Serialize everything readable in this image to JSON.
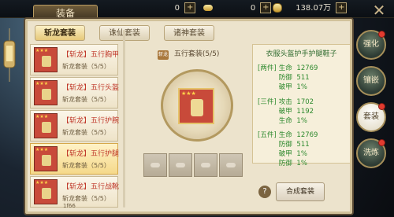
{
  "header": {
    "title": "装备",
    "currency_1": "0",
    "currency_2": "0",
    "currency_3": "138.07万"
  },
  "tabs": [
    "斩龙套装",
    "诛仙套装",
    "诸神套装"
  ],
  "list_items": [
    {
      "name": "【斩龙】五行胸甲",
      "set": "斩龙套装（5/5）",
      "selected": false
    },
    {
      "name": "【斩龙】五行头盔",
      "set": "斩龙套装（5/5）",
      "selected": false
    },
    {
      "name": "【斩龙】五行护腕",
      "set": "斩龙套装（5/5）",
      "selected": false
    },
    {
      "name": "【斩龙】五行护腿",
      "set": "斩龙套装（5/5）",
      "selected": true
    },
    {
      "name": "【斩龙】五行战靴",
      "set": "斩龙套装（5/5）",
      "selected": false
    }
  ],
  "center": {
    "badge": "斩龙",
    "set_label": "五行套装(5/5)"
  },
  "info": {
    "title": "衣服头盔护手护腿鞋子",
    "rows": [
      {
        "tier": "[两件]",
        "k": "生命",
        "v": "12769"
      },
      {
        "tier": "",
        "k": "防御",
        "v": "511"
      },
      {
        "tier": "",
        "k": "破甲",
        "v": "1%"
      },
      {
        "tier": "[三件]",
        "k": "攻击",
        "v": "1702"
      },
      {
        "tier": "",
        "k": "破甲",
        "v": "1192"
      },
      {
        "tier": "",
        "k": "生命",
        "v": "1%"
      },
      {
        "tier": "[五件]",
        "k": "生命",
        "v": "12769"
      },
      {
        "tier": "",
        "k": "防御",
        "v": "511"
      },
      {
        "tier": "",
        "k": "破甲",
        "v": "1%"
      },
      {
        "tier": "",
        "k": "防御",
        "v": "1%"
      }
    ]
  },
  "actions": {
    "help": "?",
    "craft": "合成套装"
  },
  "side_tabs": [
    "强化",
    "镶嵌",
    "套装",
    "洗炼"
  ],
  "bottom_number": "1f66",
  "colors": {
    "accent_red": "#c0392b",
    "info_green": "#2f8a2f",
    "panel_bg": "#ece3cc"
  },
  "icons": {
    "close": "close-icon",
    "plus": "plus-icon",
    "coin": "coin-icon",
    "help": "help-icon"
  }
}
